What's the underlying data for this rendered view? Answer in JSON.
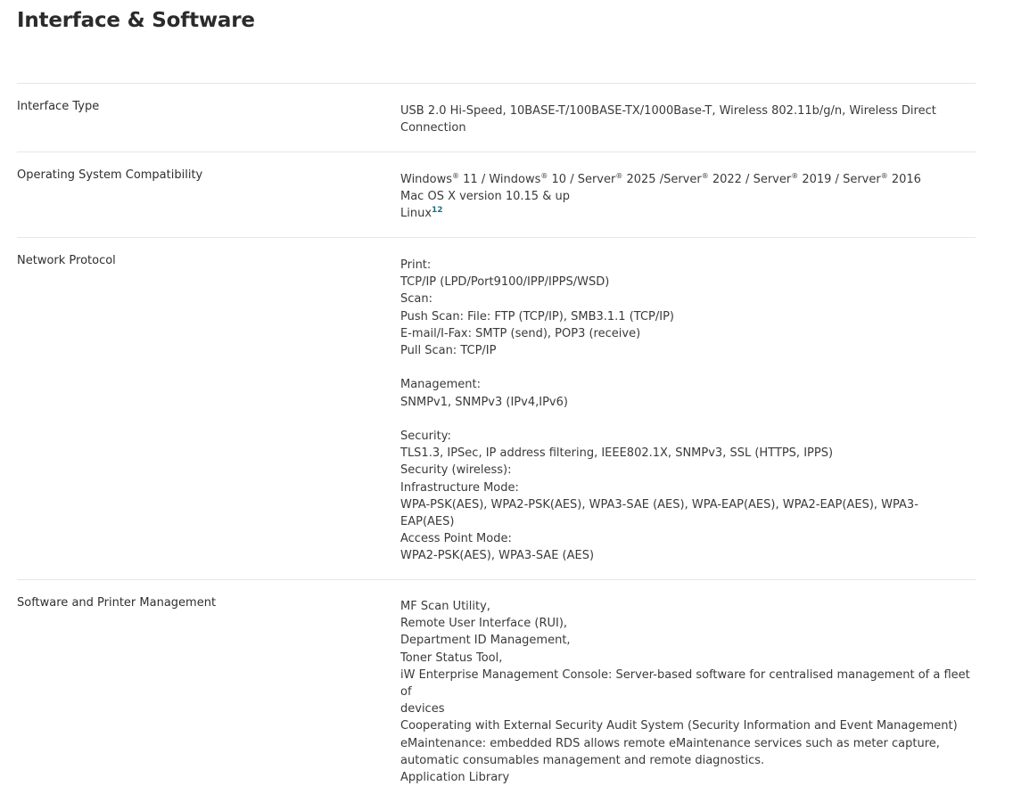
{
  "page": {
    "title": "Interface & Software"
  },
  "rows": {
    "interface_type": {
      "label": "Interface Type",
      "lines": [
        "USB 2.0 Hi-Speed, 10BASE-T/100BASE-TX/1000Base-T, Wireless 802.11b/g/n, Wireless Direct",
        "Connection"
      ]
    },
    "os_compatibility": {
      "label": "Operating System Compatibility",
      "windows": {
        "windows": "Windows",
        "reg": "®",
        "part1": " 11 / Windows",
        "part2": " 10 / Server",
        "part3": " 2025 /Server",
        "part4": " 2022 / Server",
        "part5": " 2019 / Server",
        "part6": " 2016"
      },
      "mac": "Mac OS X version 10.15 & up",
      "linux": "Linux",
      "linux_note": "12"
    },
    "network_protocol": {
      "label": "Network Protocol",
      "print_heading": "Print:",
      "print_1": "TCP/IP (LPD/Port9100/IPP/IPPS/WSD)",
      "scan_heading": "Scan:",
      "scan_1": "Push Scan: File: FTP (TCP/IP), SMB3.1.1 (TCP/IP)",
      "scan_2": "E-mail/I-Fax: SMTP (send), POP3 (receive)",
      "scan_3": "Pull Scan: TCP/IP",
      "management_heading": "Management:",
      "management_1": "SNMPv1, SNMPv3 (IPv4,IPv6)",
      "security_heading": "Security:",
      "security_1": "TLS1.3, IPSec, IP address filtering, IEEE802.1X, SNMPv3, SSL (HTTPS, IPPS)",
      "security_wireless": "Security (wireless):",
      "infra_heading": "Infrastructure Mode:",
      "infra_1": "WPA-PSK(AES), WPA2-PSK(AES), WPA3-SAE (AES), WPA-EAP(AES), WPA2-EAP(AES), WPA3-",
      "infra_2": "EAP(AES)",
      "ap_heading": "Access Point Mode:",
      "ap_1": "WPA2-PSK(AES), WPA3-SAE (AES)"
    },
    "software_management": {
      "label": "Software and Printer Management",
      "line_1": "MF Scan Utility,",
      "line_2": "Remote User Interface (RUI),",
      "line_3": "Department ID Management,",
      "line_4": "Toner Status Tool,",
      "line_5": "iW Enterprise Management Console: Server-based software for centralised management of a fleet of",
      "line_6": "devices",
      "line_7": "Cooperating with External Security Audit System (Security Information and Event Management)",
      "line_8": "eMaintenance: embedded RDS allows remote eMaintenance services such as meter capture,",
      "line_9": "automatic consumables management and remote diagnostics.",
      "line_10": "Application Library"
    }
  }
}
